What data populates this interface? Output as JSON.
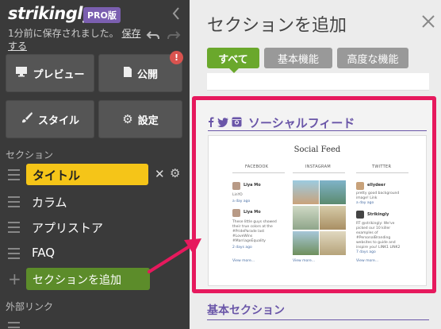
{
  "sidebar": {
    "logo": "strikingly",
    "pro_badge": "PRO版",
    "saved_text": "1分前に保存されました。",
    "saved_link": "保存する",
    "buttons": {
      "preview": "プレビュー",
      "publish": "公開",
      "style": "スタイル",
      "settings": "設定"
    },
    "alert_badge": "!",
    "sections_label": "セクション",
    "sections": [
      {
        "label": "タイトル"
      },
      {
        "label": "カラム"
      },
      {
        "label": "アプリストア"
      },
      {
        "label": "FAQ"
      }
    ],
    "add_section": "セクションを追加",
    "external_links_label": "外部リンク"
  },
  "panel": {
    "title": "セクションを追加",
    "tabs": [
      "すべて",
      "基本機能",
      "高度な機能"
    ],
    "active_tab": "すべて",
    "feed_card": {
      "title": "ソーシャルフィード",
      "preview": {
        "heading": "Social Feed",
        "columns": [
          "FACEBOOK",
          "INSTAGRAM",
          "TWITTER"
        ],
        "fb_posts": [
          {
            "name": "Liya Mo",
            "text": "LinYO",
            "time": "a day ago"
          },
          {
            "name": "Liya Mo",
            "text": "These little guys showed their true colors at the #PrideParade last #LoveWins #MarriageEquality",
            "time": "2 days ago"
          }
        ],
        "tw_posts": [
          {
            "name": "ellydeer",
            "text": "pretty good background image! Link",
            "time": "a day ago"
          },
          {
            "name": "Strikingly",
            "text": "RT @strikingly: We've picked our 10 killer examples of #PersonalBranding websites to guide and inspire you! LINK1 LINK2",
            "time": "7 days ago"
          }
        ],
        "view_more": "View more..."
      }
    },
    "basic_section": "基本セクション"
  },
  "colors": {
    "accent_green": "#6aa82c",
    "title_yellow": "#f5c518",
    "highlight_pink": "#e6195d",
    "purple": "#6a56a8"
  }
}
